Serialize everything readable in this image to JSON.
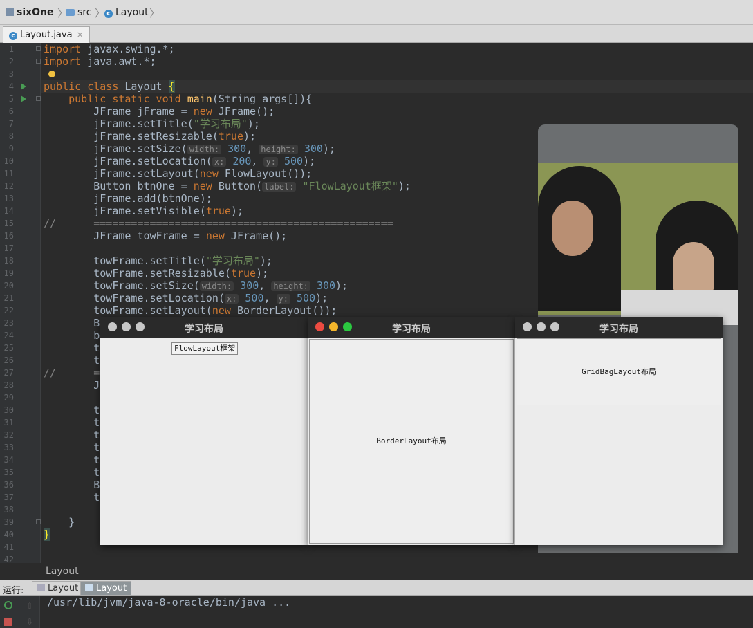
{
  "breadcrumb": {
    "project": "sixOne",
    "folder": "src",
    "file": "Layout"
  },
  "tab": {
    "label": "Layout.java",
    "close": "×"
  },
  "code_lines": [
    {
      "n": "1"
    },
    {
      "n": "2"
    },
    {
      "n": "3"
    },
    {
      "n": "4"
    },
    {
      "n": "5"
    },
    {
      "n": "6"
    },
    {
      "n": "7"
    },
    {
      "n": "8"
    },
    {
      "n": "9"
    },
    {
      "n": "10"
    },
    {
      "n": "11"
    },
    {
      "n": "12"
    },
    {
      "n": "13"
    },
    {
      "n": "14"
    },
    {
      "n": "15"
    },
    {
      "n": "16"
    },
    {
      "n": "17"
    },
    {
      "n": "18"
    },
    {
      "n": "19"
    },
    {
      "n": "20"
    },
    {
      "n": "21"
    },
    {
      "n": "22"
    },
    {
      "n": "23"
    },
    {
      "n": "24"
    },
    {
      "n": "25"
    },
    {
      "n": "26"
    },
    {
      "n": "27"
    },
    {
      "n": "28"
    },
    {
      "n": "29"
    },
    {
      "n": "30"
    },
    {
      "n": "31"
    },
    {
      "n": "32"
    },
    {
      "n": "33"
    },
    {
      "n": "34"
    },
    {
      "n": "35"
    },
    {
      "n": "36"
    },
    {
      "n": "37"
    },
    {
      "n": "38"
    },
    {
      "n": "39"
    },
    {
      "n": "40"
    },
    {
      "n": "41"
    },
    {
      "n": "42"
    }
  ],
  "code": {
    "l1_kw": "import",
    "l1": " javax.swing.*;",
    "l2_kw": "import",
    "l2": " java.awt.*;",
    "l4_kw": "public class",
    "l4": " Layout ",
    "l4_brace": "{",
    "l5_kw": "public static void",
    "l5_fn": "main",
    "l5": "(String args[]){",
    "l6": "JFrame jFrame = ",
    "l6_kw": "new",
    "l6b": " JFrame();",
    "l7": "jFrame.setTitle(",
    "l7_str": "\"学习布局\"",
    "l7b": ");",
    "l8": "jFrame.setResizable(",
    "l8_kw": "true",
    "l8b": ");",
    "l9": "jFrame.setSize(",
    "l9_h1": "width:",
    "l9_n1": "300",
    "l9_c": ", ",
    "l9_h2": "height:",
    "l9_n2": "300",
    "l9b": ");",
    "l10": "jFrame.setLocation(",
    "l10_h1": "x:",
    "l10_n1": "200",
    "l10_c": ", ",
    "l10_h2": "y:",
    "l10_n2": "500",
    "l10b": ");",
    "l11": "jFrame.setLayout(",
    "l11_kw": "new",
    "l11b": " FlowLayout());",
    "l12": "Button btnOne = ",
    "l12_kw": "new",
    "l12b": " Button(",
    "l12_h": "label:",
    "l12_str": "\"FlowLayout框架\"",
    "l12c": ");",
    "l13": "jFrame.add(btnOne);",
    "l14": "jFrame.setVisible(",
    "l14_kw": "true",
    "l14b": ");",
    "l15_cmt": "//",
    "l15": "================================================",
    "l16": "JFrame towFrame = ",
    "l16_kw": "new",
    "l16b": " JFrame();",
    "l18": "towFrame.setTitle(",
    "l18_str": "\"学习布局\"",
    "l18b": ");",
    "l19": "towFrame.setResizable(",
    "l19_kw": "true",
    "l19b": ");",
    "l20": "towFrame.setSize(",
    "l20_h1": "width:",
    "l20_n1": "300",
    "l20_c": ", ",
    "l20_h2": "height:",
    "l20_n2": "300",
    "l20b": ");",
    "l21": "towFrame.setLocation(",
    "l21_h1": "x:",
    "l21_n1": "500",
    "l21_c": ", ",
    "l21_h2": "y:",
    "l21_n2": "500",
    "l21b": ");",
    "l22": "towFrame.setLayout(",
    "l22_kw": "new",
    "l22b": " BorderLayout());",
    "l23": "B",
    "l24": "b",
    "l25": "t",
    "l26": "t",
    "l27_cmt": "//",
    "l27": "=",
    "l28": "J",
    "l30": "t",
    "l31": "t",
    "l32": "t",
    "l33": "t",
    "l34": "t",
    "l35": "t",
    "l36": "B",
    "l37": "t",
    "l39": "}",
    "l40": "}"
  },
  "windows": [
    {
      "title": "学习布局",
      "button": "FlowLayout框架"
    },
    {
      "title": "学习布局",
      "button": "BorderLayout布局"
    },
    {
      "title": "学习布局",
      "button": "GridBagLayout布局"
    }
  ],
  "run_panel": {
    "title": "Layout",
    "label": "运行:",
    "tabs": [
      "Layout",
      "Layout"
    ],
    "console_line": "/usr/lib/jvm/java-8-oracle/bin/java ..."
  },
  "colors": {
    "keyword": "#cc7832",
    "string": "#6a8759",
    "number": "#6897bb",
    "function": "#ffc66d",
    "close_light": "#ec4b41",
    "min_light": "#f3b52b",
    "max_light": "#2bc840"
  }
}
